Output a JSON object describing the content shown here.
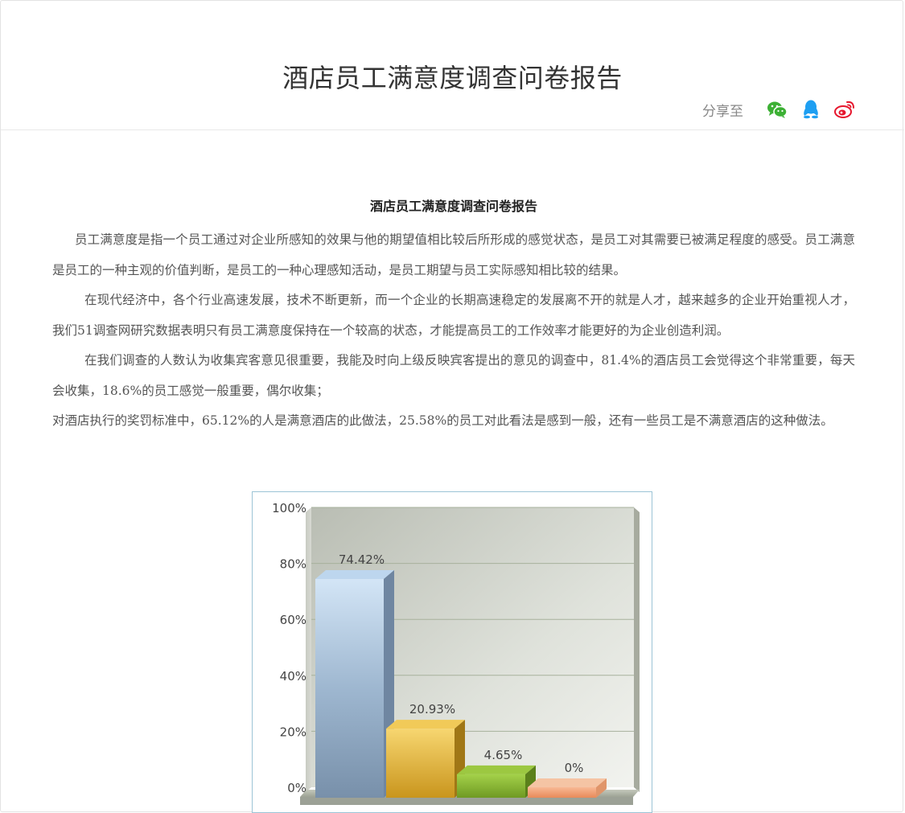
{
  "header": {
    "title": "酒店员工满意度调查问卷报告",
    "share_label": "分享至",
    "share_icons": [
      "wechat-icon",
      "qq-icon",
      "weibo-icon"
    ]
  },
  "article": {
    "title": "酒店员工满意度调查问卷报告",
    "paragraphs": [
      "员工满意度是指一个员工通过对企业所感知的效果与他的期望值相比较后所形成的感觉状态，是员工对其需要已被满足程度的感受。员工满意是员工的一种主观的价值判断，是员工的一种心理感知活动，是员工期望与员工实际感知相比较的结果。",
      "在现代经济中，各个行业高速发展，技术不断更新，而一个企业的长期高速稳定的发展离不开的就是人才，越来越多的企业开始重视人才，我们51调查网研究数据表明只有员工满意度保持在一个较高的状态，才能提高员工的工作效率才能更好的为企业创造利润。",
      "在我们调查的人数认为收集宾客意见很重要，我能及时向上级反映宾客提出的意见的调查中，81.4%的酒店员工会觉得这个非常重要，每天会收集，18.6%的员工感觉一般重要，偶尔收集；",
      "对酒店执行的奖罚标准中，65.12%的人是满意酒店的此做法，25.58%的员工对此看法是感到一般，还有一些员工是不满意酒店的这种做法。"
    ]
  },
  "colors": {
    "wechat": "#3cb034",
    "qq": "#1e9ff2",
    "weibo": "#e6162d"
  },
  "chart_data": {
    "type": "bar",
    "categories": [
      "",
      "",
      "",
      ""
    ],
    "values": [
      74.42,
      20.93,
      4.65,
      0
    ],
    "value_labels": [
      "74.42%",
      "20.93%",
      "4.65%",
      "0%"
    ],
    "ylim": [
      0,
      100
    ],
    "yticks": [
      "0%",
      "20%",
      "40%",
      "60%",
      "80%",
      "100%"
    ],
    "grid": true,
    "colors": [
      "#a9c3de",
      "#e9b73a",
      "#8ab833",
      "#f0a07a"
    ]
  }
}
